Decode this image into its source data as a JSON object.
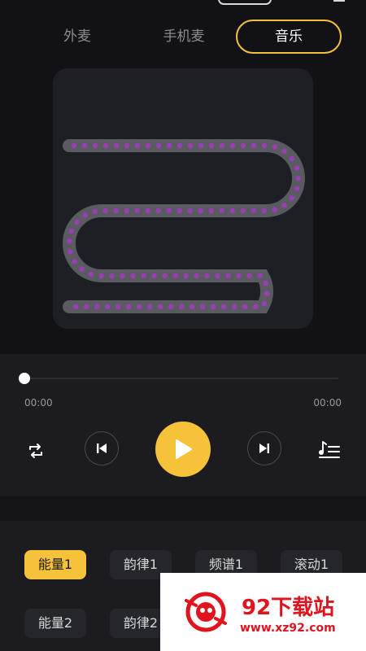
{
  "tabs": [
    {
      "label": "外麦",
      "active": false
    },
    {
      "label": "手机麦",
      "active": false
    },
    {
      "label": "音乐",
      "active": true
    }
  ],
  "player": {
    "current_time": "00:00",
    "total_time": "00:00",
    "progress": 0
  },
  "presets": [
    {
      "label": "能量1",
      "active": true
    },
    {
      "label": "韵律1",
      "active": false
    },
    {
      "label": "频谱1",
      "active": false
    },
    {
      "label": "滚动1",
      "active": false
    },
    {
      "label": "能量2",
      "active": false
    },
    {
      "label": "韵律2",
      "active": false
    }
  ],
  "watermark": {
    "title": "92下载站",
    "url": "www.xz92.com"
  },
  "colors": {
    "accent": "#f6c23a",
    "background": "#121216",
    "panel": "#1b1b20",
    "led_track": "#5a5b60",
    "led_dot": "#9b3db8",
    "watermark": "#e0141e"
  },
  "icons": {
    "loop": "loop-icon",
    "prev": "skip-previous-icon",
    "play": "play-icon",
    "next": "skip-next-icon",
    "playlist": "playlist-icon"
  }
}
